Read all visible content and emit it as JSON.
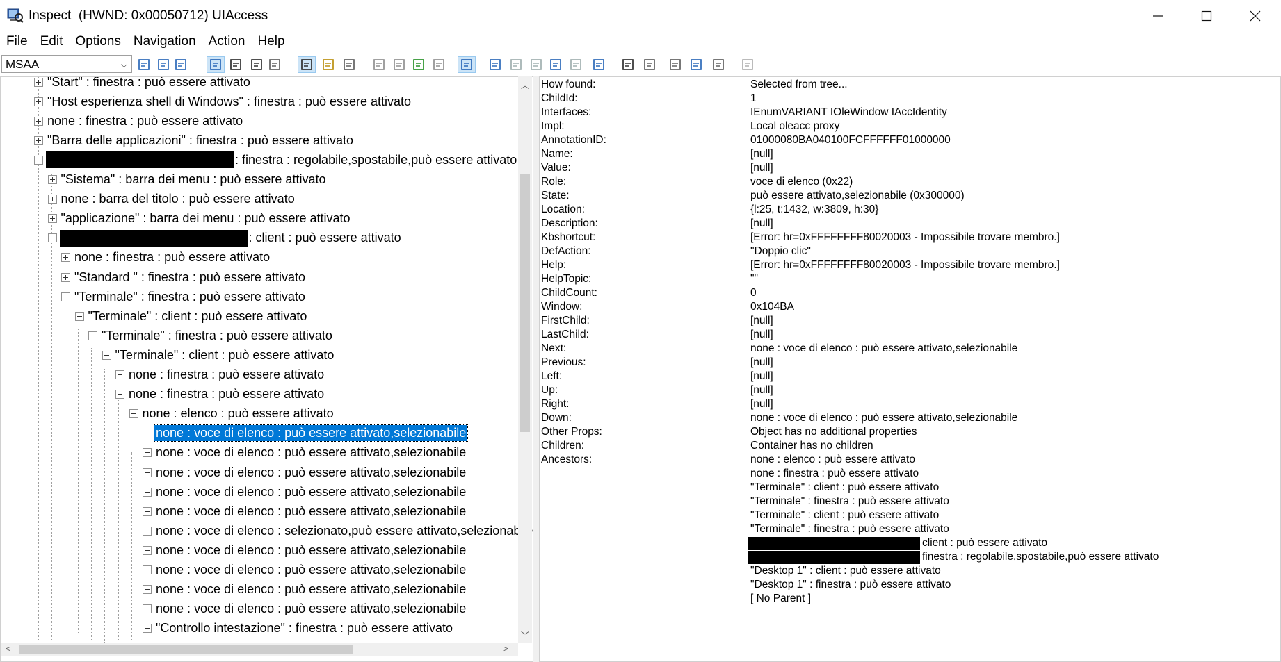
{
  "window": {
    "title": "Inspect  (HWND: 0x00050712) UIAccess",
    "minimize": "—",
    "maximize": "☐",
    "close": "✕"
  },
  "menu": [
    {
      "label": "File"
    },
    {
      "label": "Edit"
    },
    {
      "label": "Options"
    },
    {
      "label": "Navigation"
    },
    {
      "label": "Action"
    },
    {
      "label": "Help"
    }
  ],
  "toolbar": {
    "mode_value": "MSAA",
    "buttons": [
      "refresh-icon",
      "copy-icon",
      "properties-icon",
      "watch-cursor-icon",
      "text-cursor-icon",
      "watch-mouse-icon",
      "watch-tracking-icon",
      "highlight-rect-icon",
      "show-caret-icon",
      "show-focus-icon",
      "nav-back-icon",
      "nav-up-icon",
      "nav-down-icon",
      "nav-forward-icon",
      "tree-view-icon",
      "navigate-parent-icon",
      "navigate-first-child-icon",
      "navigate-prev-icon",
      "navigate-next-icon",
      "navigate-last-child-icon",
      "navigate-child-icon",
      "do-default-action-icon",
      "select-icon",
      "take-focus-icon",
      "add-selection-icon",
      "remove-selection-icon",
      "disabled-icon"
    ]
  },
  "tree": [
    {
      "text": "\"Start\" : finestra : può essere attivato",
      "level": 0,
      "box": "plus"
    },
    {
      "text": "\"Host esperienza shell di Windows\" : finestra : può essere attivato",
      "level": 0,
      "box": "plus"
    },
    {
      "text": "none : finestra : può essere attivato",
      "level": 0,
      "box": "plus"
    },
    {
      "text": "\"Barra delle applicazioni\" : finestra : può essere attivato",
      "level": 0,
      "box": "plus"
    },
    {
      "text": ": finestra : regolabile,spostabile,può essere attivato",
      "level": 0,
      "box": "minus",
      "redact": 270
    },
    {
      "text": "\"Sistema\" : barra dei menu : può essere attivato",
      "level": 1,
      "box": "plus"
    },
    {
      "text": "none : barra del titolo : può essere attivato",
      "level": 1,
      "box": "plus"
    },
    {
      "text": "\"applicazione\" : barra dei menu : può essere attivato",
      "level": 1,
      "box": "plus"
    },
    {
      "text": ": client : può essere attivato",
      "level": 1,
      "box": "minus",
      "redact": 270
    },
    {
      "text": "none : finestra : può essere attivato",
      "level": 2,
      "box": "plus"
    },
    {
      "text": "\"Standard \" : finestra : può essere attivato",
      "level": 2,
      "box": "plus"
    },
    {
      "text": "\"Terminale\" : finestra : può essere attivato",
      "level": 2,
      "box": "minus"
    },
    {
      "text": "\"Terminale\" : client : può essere attivato",
      "level": 3,
      "box": "minus"
    },
    {
      "text": "\"Terminale\" : finestra : può essere attivato",
      "level": 4,
      "box": "minus"
    },
    {
      "text": "\"Terminale\" : client : può essere attivato",
      "level": 5,
      "box": "minus"
    },
    {
      "text": "none : finestra : può essere attivato",
      "level": 6,
      "box": "plus"
    },
    {
      "text": "none : finestra : può essere attivato",
      "level": 6,
      "box": "minus"
    },
    {
      "text": "none : elenco : può essere attivato",
      "level": 7,
      "box": "minus"
    },
    {
      "text": "none : voce di elenco : può essere attivato,selezionabile",
      "level": 8,
      "box": "none",
      "selected": true
    },
    {
      "text": "none : voce di elenco : può essere attivato,selezionabile",
      "level": 8,
      "box": "plus"
    },
    {
      "text": "none : voce di elenco : può essere attivato,selezionabile",
      "level": 8,
      "box": "plus"
    },
    {
      "text": "none : voce di elenco : può essere attivato,selezionabile",
      "level": 8,
      "box": "plus"
    },
    {
      "text": "none : voce di elenco : può essere attivato,selezionabile",
      "level": 8,
      "box": "plus"
    },
    {
      "text": "none : voce di elenco : selezionato,può essere attivato,selezionabile",
      "level": 8,
      "box": "plus"
    },
    {
      "text": "none : voce di elenco : può essere attivato,selezionabile",
      "level": 8,
      "box": "plus"
    },
    {
      "text": "none : voce di elenco : può essere attivato,selezionabile",
      "level": 8,
      "box": "plus"
    },
    {
      "text": "none : voce di elenco : può essere attivato,selezionabile",
      "level": 8,
      "box": "plus"
    },
    {
      "text": "none : voce di elenco : può essere attivato,selezionabile",
      "level": 8,
      "box": "plus"
    },
    {
      "text": "\"Controllo intestazione\" : finestra : può essere attivato",
      "level": 8,
      "box": "plus"
    }
  ],
  "properties": [
    {
      "key": "How found:",
      "value": "Selected from tree..."
    },
    {
      "key": "ChildId:",
      "value": "1"
    },
    {
      "key": "Interfaces:",
      "value": "IEnumVARIANT IOleWindow IAccIdentity"
    },
    {
      "key": "Impl:",
      "value": "Local oleacc proxy"
    },
    {
      "key": "AnnotationID:",
      "value": "01000080BA040100FCFFFFFF01000000"
    },
    {
      "key": "Name:",
      "value": "[null]"
    },
    {
      "key": "Value:",
      "value": "[null]"
    },
    {
      "key": "Role:",
      "value": "voce di elenco (0x22)"
    },
    {
      "key": "State:",
      "value": "può essere attivato,selezionabile (0x300000)"
    },
    {
      "key": "Location:",
      "value": "{l:25, t:1432, w:3809, h:30}"
    },
    {
      "key": "Description:",
      "value": "[null]"
    },
    {
      "key": "Kbshortcut:",
      "value": "[Error: hr=0xFFFFFFFF80020003 - Impossibile trovare membro.]"
    },
    {
      "key": "DefAction:",
      "value": "\"Doppio clic\""
    },
    {
      "key": "Help:",
      "value": "[Error: hr=0xFFFFFFFF80020003 - Impossibile trovare membro.]"
    },
    {
      "key": "HelpTopic:",
      "value": "\"\""
    },
    {
      "key": "ChildCount:",
      "value": "0"
    },
    {
      "key": "Window:",
      "value": "0x104BA"
    },
    {
      "key": "FirstChild:",
      "value": "[null]"
    },
    {
      "key": "LastChild:",
      "value": "[null]"
    },
    {
      "key": "Next:",
      "value": "none : voce di elenco : può essere attivato,selezionabile"
    },
    {
      "key": "Previous:",
      "value": "[null]"
    },
    {
      "key": "Left:",
      "value": "[null]"
    },
    {
      "key": "Up:",
      "value": "[null]"
    },
    {
      "key": "Right:",
      "value": "[null]"
    },
    {
      "key": "Down:",
      "value": "none : voce di elenco : può essere attivato,selezionabile"
    },
    {
      "key": "Other Props:",
      "value": "Object has no additional properties"
    },
    {
      "key": "Children:",
      "value": "Container has no children"
    },
    {
      "key": "Ancestors:",
      "value": "none : elenco : può essere attivato"
    },
    {
      "key": "",
      "value": "none : finestra : può essere attivato"
    },
    {
      "key": "",
      "value": "\"Terminale\" : client : può essere attivato"
    },
    {
      "key": "",
      "value": "\"Terminale\" : finestra : può essere attivato"
    },
    {
      "key": "",
      "value": "\"Terminale\" : client : può essere attivato"
    },
    {
      "key": "",
      "value": "\"Terminale\" : finestra : può essere attivato"
    },
    {
      "key": "",
      "value": "client : può essere attivato",
      "redacted": true
    },
    {
      "key": "",
      "value": "finestra : regolabile,spostabile,può essere attivato",
      "redacted": true
    },
    {
      "key": "",
      "value": "\"Desktop 1\" : client : può essere attivato"
    },
    {
      "key": "",
      "value": "\"Desktop 1\" : finestra : può essere attivato"
    },
    {
      "key": "",
      "value": "[ No Parent ]"
    }
  ]
}
